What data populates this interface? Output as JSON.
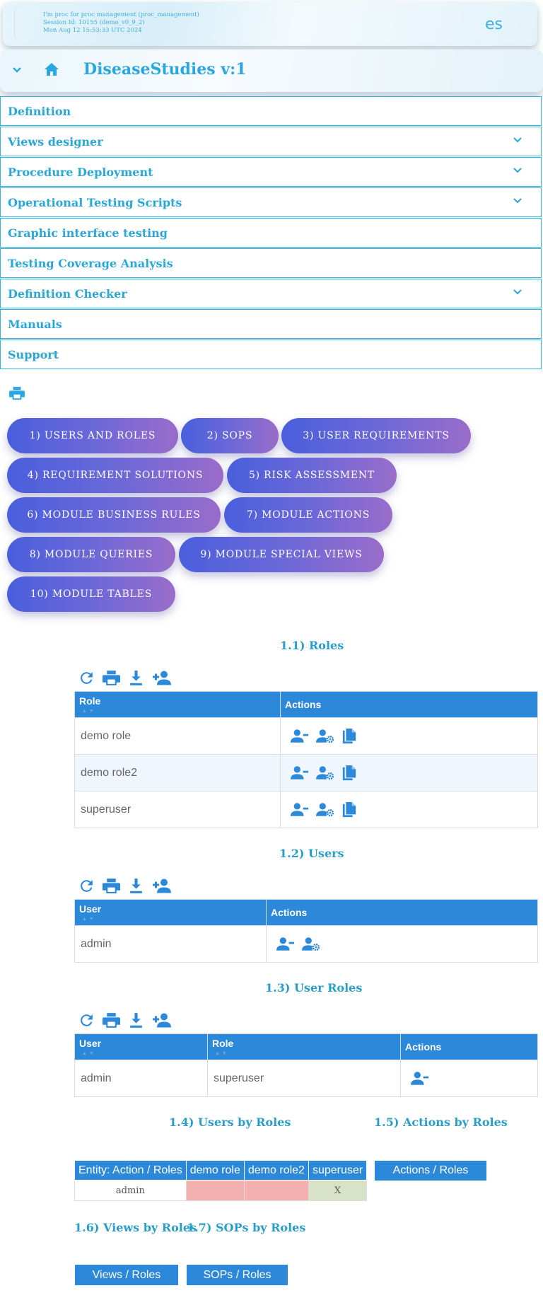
{
  "header": {
    "session_line1": "I'm proc for proc management (proc_management)",
    "session_line2": "Session Id: 10155 (demo_v0_9_2)",
    "session_line3": "Mon Aug 12 15:53:33 UTC 2024",
    "language": "es"
  },
  "title_bar": {
    "title": "DiseaseStudies v:1"
  },
  "menu": {
    "items": [
      {
        "label": "Definition"
      },
      {
        "label": "Views designer"
      },
      {
        "label": "Procedure Deployment"
      },
      {
        "label": "Operational Testing Scripts"
      },
      {
        "label": "Graphic interface testing"
      },
      {
        "label": "Testing Coverage Analysis"
      },
      {
        "label": "Definition Checker"
      },
      {
        "label": "Manuals"
      },
      {
        "label": "Support"
      }
    ]
  },
  "tabs": [
    {
      "label": "1) USERS AND ROLES"
    },
    {
      "label": "2) SOPS"
    },
    {
      "label": "3) USER REQUIREMENTS"
    },
    {
      "label": "4) REQUIREMENT SOLUTIONS"
    },
    {
      "label": "5) RISK ASSESSMENT"
    },
    {
      "label": "6) MODULE BUSINESS RULES"
    },
    {
      "label": "7) MODULE ACTIONS"
    },
    {
      "label": "8) MODULE QUERIES"
    },
    {
      "label": "9) MODULE SPECIAL VIEWS"
    },
    {
      "label": "10) MODULE TABLES"
    }
  ],
  "roles": {
    "title": "1.1) Roles",
    "headers": {
      "role": "Role",
      "actions": "Actions"
    },
    "rows": [
      "demo role",
      "demo role2",
      "superuser"
    ]
  },
  "users": {
    "title": "1.2) Users",
    "headers": {
      "user": "User",
      "actions": "Actions"
    },
    "rows": [
      "admin"
    ]
  },
  "user_roles": {
    "title": "1.3) User Roles",
    "headers": {
      "user": "User",
      "role": "Role",
      "actions": "Actions"
    },
    "rows": [
      {
        "user": "admin",
        "role": "superuser"
      }
    ]
  },
  "users_by_roles": {
    "title": "1.4) Users by Roles",
    "headers": [
      "Entity: Action / Roles",
      "demo role",
      "demo role2",
      "superuser"
    ],
    "rows": [
      {
        "entity": "admin",
        "cells": [
          "",
          "",
          "X"
        ]
      }
    ]
  },
  "actions_by_roles": {
    "title": "1.5) Actions by Roles",
    "button": "Actions / Roles"
  },
  "views_by_roles": {
    "title": "1.6) Views by Roles",
    "button": "Views / Roles"
  },
  "sops_by_roles": {
    "title": "1.7) SOPs by Roles",
    "button": "SOPs / Roles"
  },
  "colors": {
    "accent": "#2aa7d6",
    "table_header": "#2c88d9",
    "denied_cell": "#f2b0ae",
    "granted_cell": "#d8e2c6"
  }
}
